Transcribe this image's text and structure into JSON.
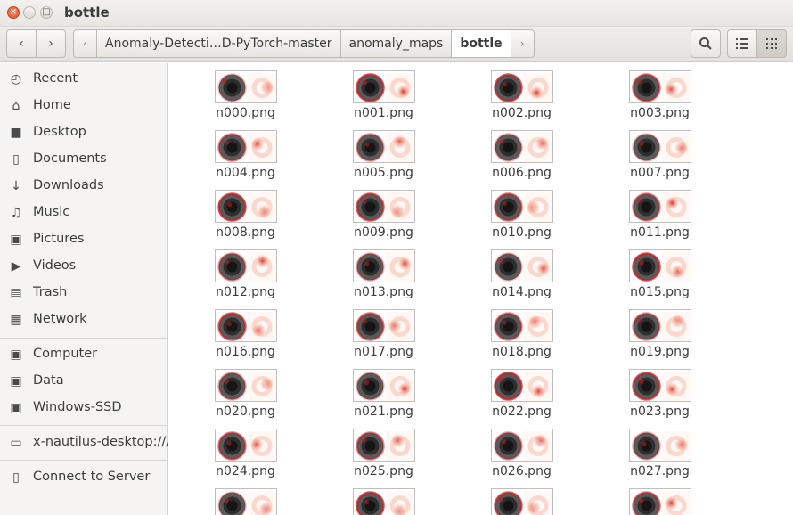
{
  "window": {
    "title": "bottle"
  },
  "toolbar": {
    "breadcrumbs": [
      "Anomaly-Detecti…D-PyTorch-master",
      "anomaly_maps",
      "bottle"
    ]
  },
  "sidebar": {
    "items": [
      {
        "label": "Recent",
        "icon": "clock-icon"
      },
      {
        "label": "Home",
        "icon": "home-icon"
      },
      {
        "label": "Desktop",
        "icon": "folder-icon"
      },
      {
        "label": "Documents",
        "icon": "document-icon"
      },
      {
        "label": "Downloads",
        "icon": "download-icon"
      },
      {
        "label": "Music",
        "icon": "music-icon"
      },
      {
        "label": "Pictures",
        "icon": "camera-icon"
      },
      {
        "label": "Videos",
        "icon": "video-icon"
      },
      {
        "label": "Trash",
        "icon": "trash-icon"
      },
      {
        "label": "Network",
        "icon": "network-icon"
      },
      {
        "label": "Computer",
        "icon": "drive-icon"
      },
      {
        "label": "Data",
        "icon": "drive-icon"
      },
      {
        "label": "Windows-SSD",
        "icon": "drive-icon"
      },
      {
        "label": "x-nautilus-desktop:///",
        "icon": "monitor-icon"
      },
      {
        "label": "Connect to Server",
        "icon": "server-icon"
      }
    ]
  },
  "files": [
    "n000.png",
    "n001.png",
    "n002.png",
    "n003.png",
    "n004.png",
    "n005.png",
    "n006.png",
    "n007.png",
    "n008.png",
    "n009.png",
    "n010.png",
    "n011.png",
    "n012.png",
    "n013.png",
    "n014.png",
    "n015.png",
    "n016.png",
    "n017.png",
    "n018.png",
    "n019.png",
    "n020.png",
    "n021.png",
    "n022.png",
    "n023.png",
    "n024.png",
    "n025.png",
    "n026.png",
    "n027.png",
    "",
    "",
    "",
    ""
  ],
  "colors": {
    "accent": "#e2532a",
    "heat": "#d4161b"
  }
}
